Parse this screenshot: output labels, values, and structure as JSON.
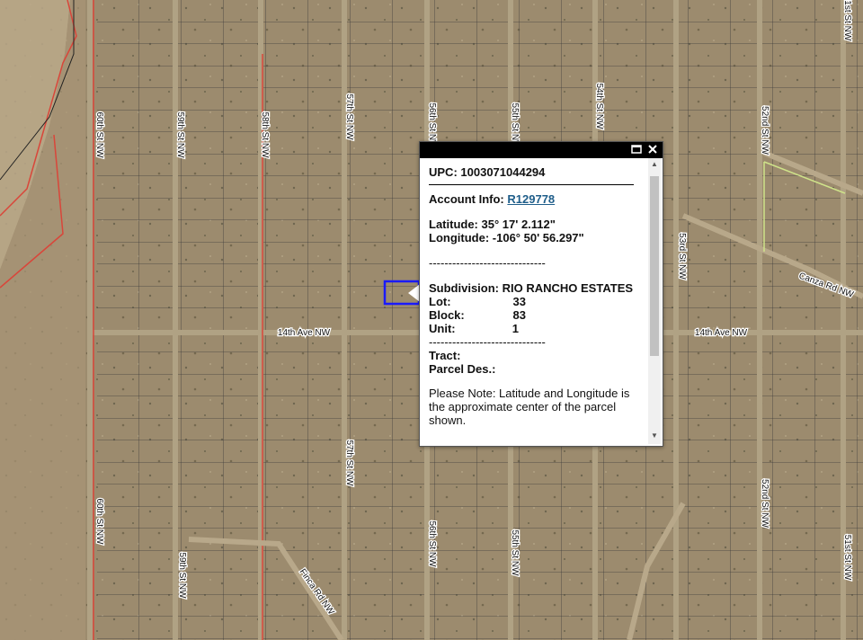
{
  "map": {
    "background_color": "#9c8b6e",
    "street_labels": [
      {
        "text": "60th St NW"
      },
      {
        "text": "59th St NW"
      },
      {
        "text": "58th St NW"
      },
      {
        "text": "57th St NW"
      },
      {
        "text": "56th St NW"
      },
      {
        "text": "55th St NW"
      },
      {
        "text": "54th St NW"
      },
      {
        "text": "53rd St NW"
      },
      {
        "text": "52nd St NW"
      },
      {
        "text": "51st St NW"
      },
      {
        "text": "14th Ave NW"
      },
      {
        "text": "14th Ave NW"
      },
      {
        "text": "57th St NW"
      },
      {
        "text": "56th St NW"
      },
      {
        "text": "55th St NW"
      },
      {
        "text": "52nd St NW"
      },
      {
        "text": "51st St NW"
      },
      {
        "text": "59th St NW"
      },
      {
        "text": "60th St NW"
      },
      {
        "text": "Finca Rd NW"
      },
      {
        "text": "Canza Rd NW"
      }
    ]
  },
  "popup": {
    "upc_label": "UPC:",
    "upc_value": "1003071044294",
    "account_label": "Account Info:",
    "account_value": "R129778",
    "latitude_label": "Latitude:",
    "latitude_value": "35° 17' 2.112\"",
    "longitude_label": "Longitude:",
    "longitude_value": "-106° 50' 56.297\"",
    "separator": "------------------------------",
    "subdivision_label": "Subdivision:",
    "subdivision_value": "RIO RANCHO ESTATES",
    "lot_label": "Lot:",
    "lot_value": "33",
    "block_label": "Block:",
    "block_value": "83",
    "unit_label": "Unit:",
    "unit_value": "1",
    "tract_label": "Tract:",
    "parcel_label": "Parcel Des.:",
    "note": "Please Note: Latitude and Longitude is the approximate center of the parcel shown."
  },
  "colors": {
    "parcel_line": "#3b3b3b",
    "selected_parcel": "#1a1aff",
    "red_boundary": "#d9463a"
  }
}
